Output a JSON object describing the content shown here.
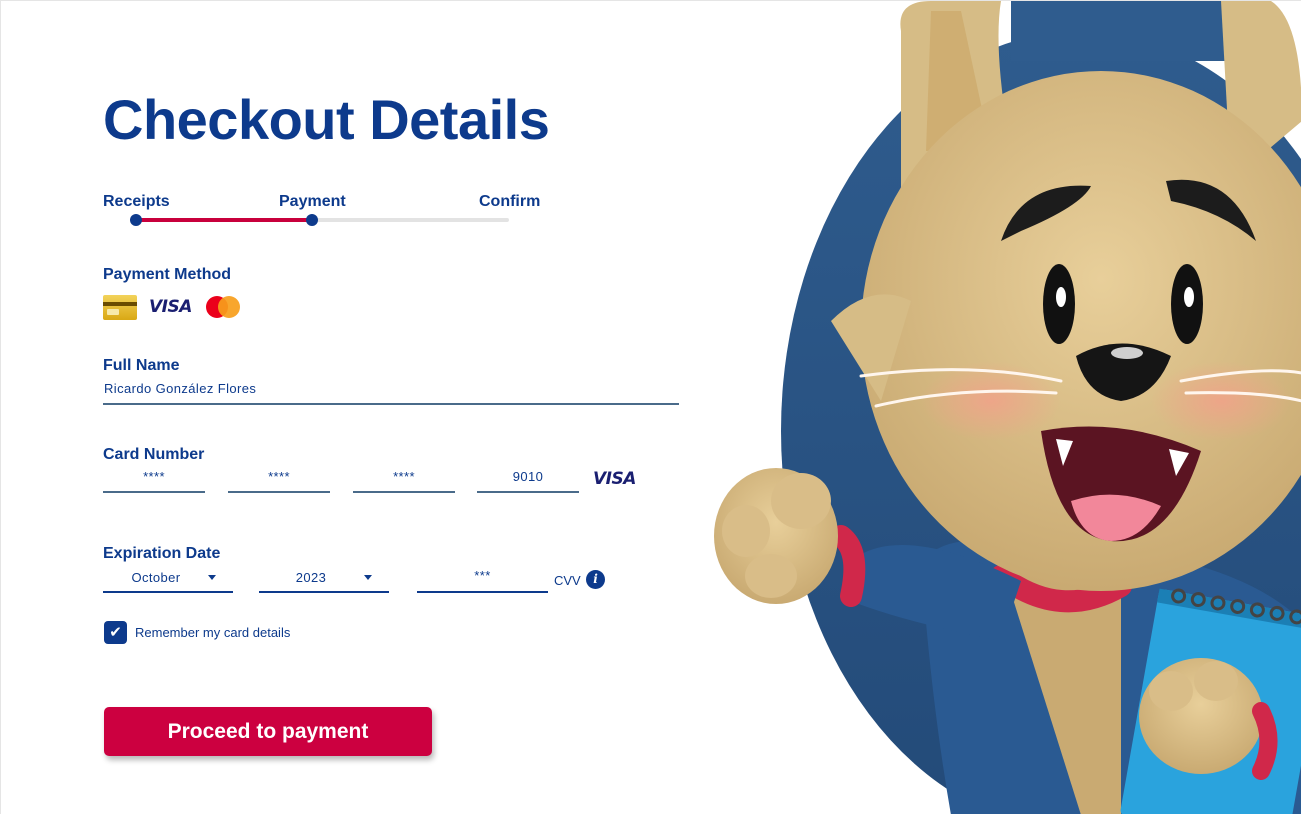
{
  "page": {
    "title": "Checkout Details"
  },
  "stepper": {
    "steps": [
      {
        "label": "Receipts",
        "state": "done"
      },
      {
        "label": "Payment",
        "state": "active"
      },
      {
        "label": "Confirm",
        "state": "pending"
      }
    ],
    "progress_color": "#c8003c"
  },
  "payment_method": {
    "label": "Payment Method",
    "options": [
      {
        "name": "generic-card-icon"
      },
      {
        "name": "visa-logo",
        "text": "VISA"
      },
      {
        "name": "mastercard-logo"
      }
    ]
  },
  "full_name": {
    "label": "Full Name",
    "value": "Ricardo González Flores"
  },
  "card_number": {
    "label": "Card Number",
    "segments": [
      "****",
      "****",
      "****",
      "9010"
    ],
    "brand": "VISA"
  },
  "expiration": {
    "label": "Expiration Date",
    "month": "October",
    "year": "2023",
    "cvv_value": "***",
    "cvv_label": "CVV",
    "info_icon": "i"
  },
  "remember": {
    "label": "Remember my card details",
    "checked": true,
    "check_glyph": "✔"
  },
  "actions": {
    "proceed_label": "Proceed to payment"
  },
  "colors": {
    "primary": "#0d3a8c",
    "accent": "#cc0040"
  },
  "illustration": {
    "subject": "cartoon-cat-mascot-holding-notebook"
  }
}
